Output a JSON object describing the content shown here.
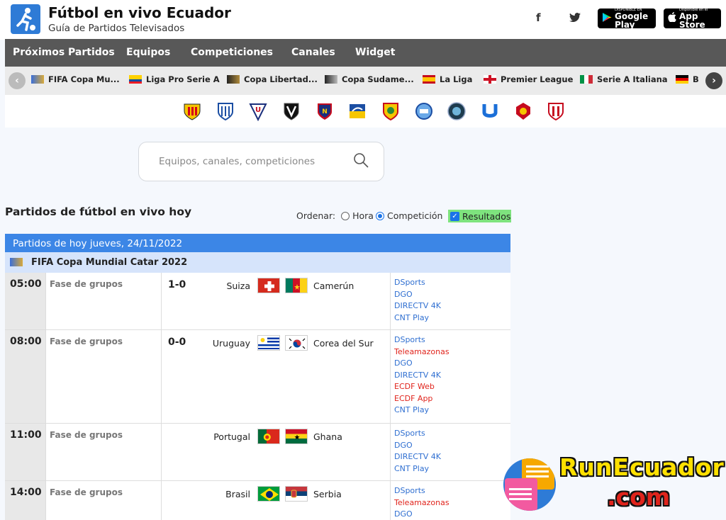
{
  "header": {
    "title": "Fútbol en vivo Ecuador",
    "subtitle": "Guía de Partidos Televisados",
    "social": [
      {
        "icon": "facebook-icon",
        "glyph": "f"
      },
      {
        "icon": "twitter-icon",
        "glyph": "🐦"
      }
    ],
    "google_play": {
      "small": "DISPONIBLE EN",
      "big": "Google Play"
    },
    "app_store": {
      "small": "Disponible en el",
      "big": "App Store"
    }
  },
  "nav": {
    "items": [
      "Próximos Partidos",
      "Equipos",
      "Competiciones",
      "Canales",
      "Widget"
    ]
  },
  "competitions": {
    "items": [
      {
        "label": "FIFA Copa Mu...",
        "flag": "world-cup"
      },
      {
        "label": "Liga Pro Serie A",
        "flag": "ecuador"
      },
      {
        "label": "Copa Libertad...",
        "flag": "libertadores"
      },
      {
        "label": "Copa Sudame...",
        "flag": "sudamericana"
      },
      {
        "label": "La Liga",
        "flag": "spain"
      },
      {
        "label": "Premier League",
        "flag": "england"
      },
      {
        "label": "Serie A Italiana",
        "flag": "italy"
      },
      {
        "label": "B",
        "flag": "germany"
      }
    ]
  },
  "teams_strip": {
    "badges": [
      "barcelona-sc",
      "emelec",
      "ldu-quito",
      "independiente-del-valle",
      "el-nacional",
      "delfin",
      "aucas",
      "macara",
      "guayaquil-city",
      "universidad-catolica",
      "deportivo-cuenca",
      "tecnico-universitario"
    ]
  },
  "search": {
    "placeholder": "Equipos, canales, competiciones"
  },
  "list": {
    "title": "Partidos de fútbol en vivo hoy",
    "order_label": "Ordenar:",
    "order_hour": "Hora",
    "order_competition": "Competición",
    "results_label": "Resultados",
    "day_header": "Partidos de hoy jueves, 24/11/2022",
    "competition": "FIFA Copa Mundial Catar 2022"
  },
  "matches": [
    {
      "time": "05:00",
      "phase": "Fase de grupos",
      "score": "1-0",
      "home": "Suiza",
      "away": "Camerún",
      "channels": [
        {
          "name": "DSports",
          "color": "blue"
        },
        {
          "name": "DGO",
          "color": "blue"
        },
        {
          "name": "DIRECTV 4K",
          "color": "blue"
        },
        {
          "name": "CNT Play",
          "color": "blue"
        }
      ]
    },
    {
      "time": "08:00",
      "phase": "Fase de grupos",
      "score": "0-0",
      "home": "Uruguay",
      "away": "Corea del Sur",
      "channels": [
        {
          "name": "DSports",
          "color": "blue"
        },
        {
          "name": "Teleamazonas",
          "color": "red"
        },
        {
          "name": "DGO",
          "color": "blue"
        },
        {
          "name": "DIRECTV 4K",
          "color": "blue"
        },
        {
          "name": "ECDF Web",
          "color": "red"
        },
        {
          "name": "ECDF App",
          "color": "red"
        },
        {
          "name": "CNT Play",
          "color": "blue"
        }
      ]
    },
    {
      "time": "11:00",
      "phase": "Fase de grupos",
      "score": "",
      "home": "Portugal",
      "away": "Ghana",
      "channels": [
        {
          "name": "DSports",
          "color": "blue"
        },
        {
          "name": "DGO",
          "color": "blue"
        },
        {
          "name": "DIRECTV 4K",
          "color": "blue"
        },
        {
          "name": "CNT Play",
          "color": "blue"
        }
      ]
    },
    {
      "time": "14:00",
      "phase": "Fase de grupos",
      "score": "",
      "home": "Brasil",
      "away": "Serbia",
      "channels": [
        {
          "name": "DSports",
          "color": "blue"
        },
        {
          "name": "Teleamazonas",
          "color": "red"
        },
        {
          "name": "DGO",
          "color": "blue"
        }
      ]
    }
  ],
  "watermark": {
    "line1": "RunEcuador",
    "line2": ".com"
  },
  "colors": {
    "nav_bg": "#585858",
    "day_header": "#3c86e6",
    "comp_row": "#d6e4fb",
    "channel_blue": "#2f6fd1",
    "channel_red": "#e0241c",
    "results_bg": "#7ee37e"
  }
}
